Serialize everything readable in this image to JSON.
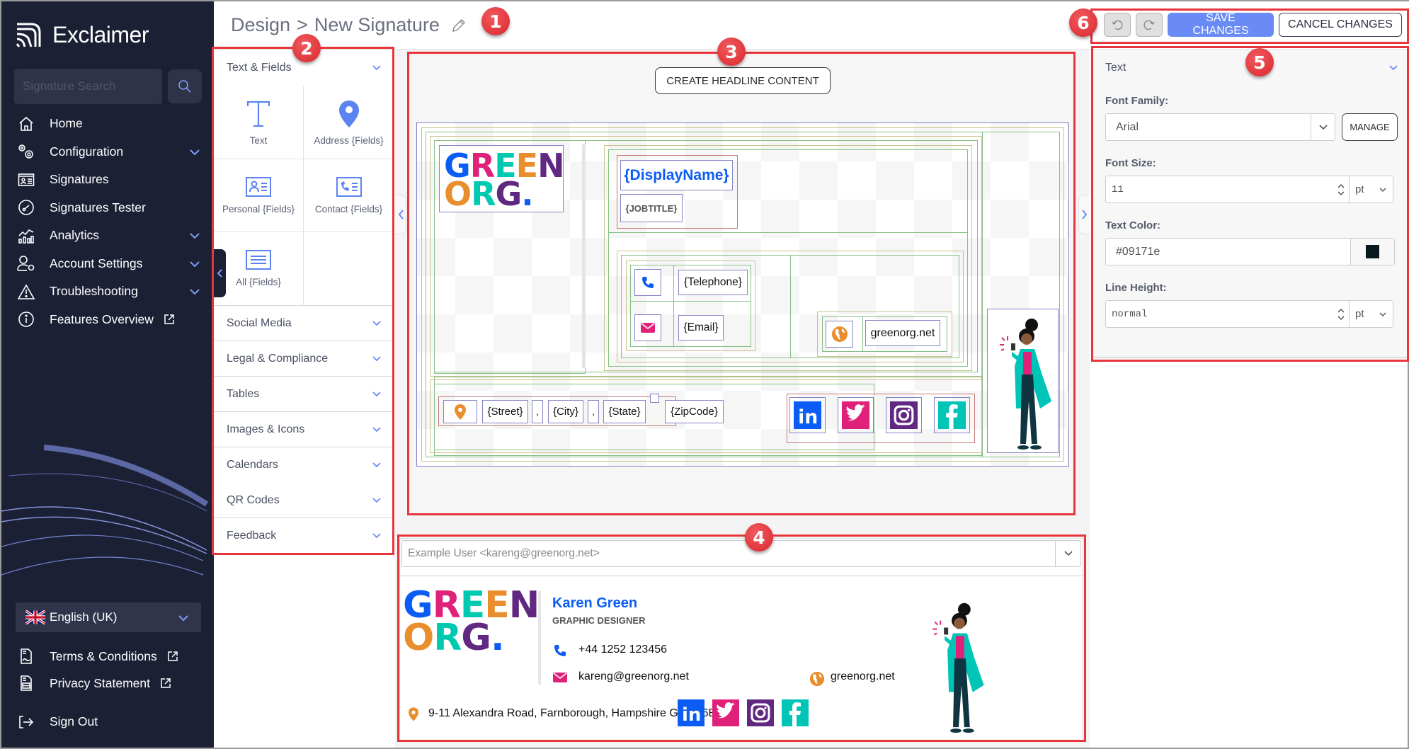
{
  "app": {
    "brand": "Exclaimer"
  },
  "sidebar": {
    "search_placeholder": "Signature Search",
    "items": [
      {
        "label": "Home",
        "icon": "home-icon",
        "expandable": false
      },
      {
        "label": "Configuration",
        "icon": "gears-icon",
        "expandable": true
      },
      {
        "label": "Signatures",
        "icon": "id-card-icon",
        "expandable": false
      },
      {
        "label": "Signatures Tester",
        "icon": "gauge-icon",
        "expandable": false
      },
      {
        "label": "Analytics",
        "icon": "chart-icon",
        "expandable": true
      },
      {
        "label": "Account Settings",
        "icon": "user-gear-icon",
        "expandable": true
      },
      {
        "label": "Troubleshooting",
        "icon": "warning-icon",
        "expandable": true
      },
      {
        "label": "Features Overview",
        "icon": "info-icon",
        "external": true
      }
    ],
    "language": "English (UK)",
    "footer": [
      {
        "label": "Terms & Conditions",
        "icon": "document-icon",
        "external": true
      },
      {
        "label": "Privacy Statement",
        "icon": "document-lines-icon",
        "external": true
      }
    ],
    "sign_out": "Sign Out"
  },
  "header": {
    "breadcrumb_root": "Design",
    "separator": ">",
    "title": "New Signature",
    "undo_label": "Undo",
    "redo_label": "Redo",
    "save_label": "SAVE CHANGES",
    "cancel_label": "CANCEL CHANGES",
    "colors": {
      "primary": "#6a8bf5"
    }
  },
  "elements_panel": {
    "sections": [
      {
        "label": "Text & Fields",
        "expanded": true,
        "tiles": [
          {
            "label": "Text",
            "icon": "text-icon"
          },
          {
            "label": "Address {Fields}",
            "icon": "map-pin-icon"
          },
          {
            "label": "Personal {Fields}",
            "icon": "personal-card-icon"
          },
          {
            "label": "Contact {Fields}",
            "icon": "contact-card-icon"
          },
          {
            "label": "All {Fields}",
            "icon": "list-card-icon"
          }
        ]
      },
      {
        "label": "Social Media"
      },
      {
        "label": "Legal & Compliance"
      },
      {
        "label": "Tables"
      },
      {
        "label": "Images & Icons"
      },
      {
        "label": "Calendars"
      },
      {
        "label": "QR Codes"
      },
      {
        "label": "Feedback"
      }
    ]
  },
  "canvas": {
    "headline_button": "CREATE HEADLINE CONTENT",
    "logo": {
      "line1": [
        "G",
        "R",
        "E",
        "E",
        "N"
      ],
      "line2": [
        "O",
        "R",
        "G"
      ],
      "dot": ".",
      "colors": [
        "#0a5cf5",
        "#e0217a",
        "#00c9b1",
        "#e98e2d",
        "#612882"
      ]
    },
    "fields": {
      "display_name": "{DisplayName}",
      "job_title": "{JOBTITLE}",
      "telephone": "{Telephone}",
      "email": "{Email}",
      "website": "greenorg.net",
      "street": "{Street}",
      "comma1": ",",
      "city": "{City}",
      "comma2": ",",
      "state": "{State}",
      "zip": "{ZipCode}"
    },
    "social": [
      {
        "name": "linkedin",
        "color": "#0a5cf5"
      },
      {
        "name": "twitter",
        "color": "#e0217a"
      },
      {
        "name": "instagram",
        "color": "#612882"
      },
      {
        "name": "facebook",
        "color": "#00c4b5"
      }
    ]
  },
  "preview": {
    "user_select": "Example User <kareng@greenorg.net>",
    "name": "Karen Green",
    "job_title": "GRAPHIC DESIGNER",
    "phone": "+44 1252 123456",
    "email": "kareng@greenorg.net",
    "website": "greenorg.net",
    "address": "9-11 Alexandra Road, Farnborough, Hampshire GU14 6BU"
  },
  "properties": {
    "section": "Text",
    "font_family_label": "Font Family:",
    "font_family": "Arial",
    "manage_label": "MANAGE",
    "font_size_label": "Font Size:",
    "font_size": "11",
    "font_size_unit": "pt",
    "text_color_label": "Text Color:",
    "text_color": "#09171e",
    "line_height_label": "Line Height:",
    "line_height": "normal",
    "line_height_unit": "pt"
  },
  "annotations": [
    "1",
    "2",
    "3",
    "4",
    "5",
    "6"
  ]
}
